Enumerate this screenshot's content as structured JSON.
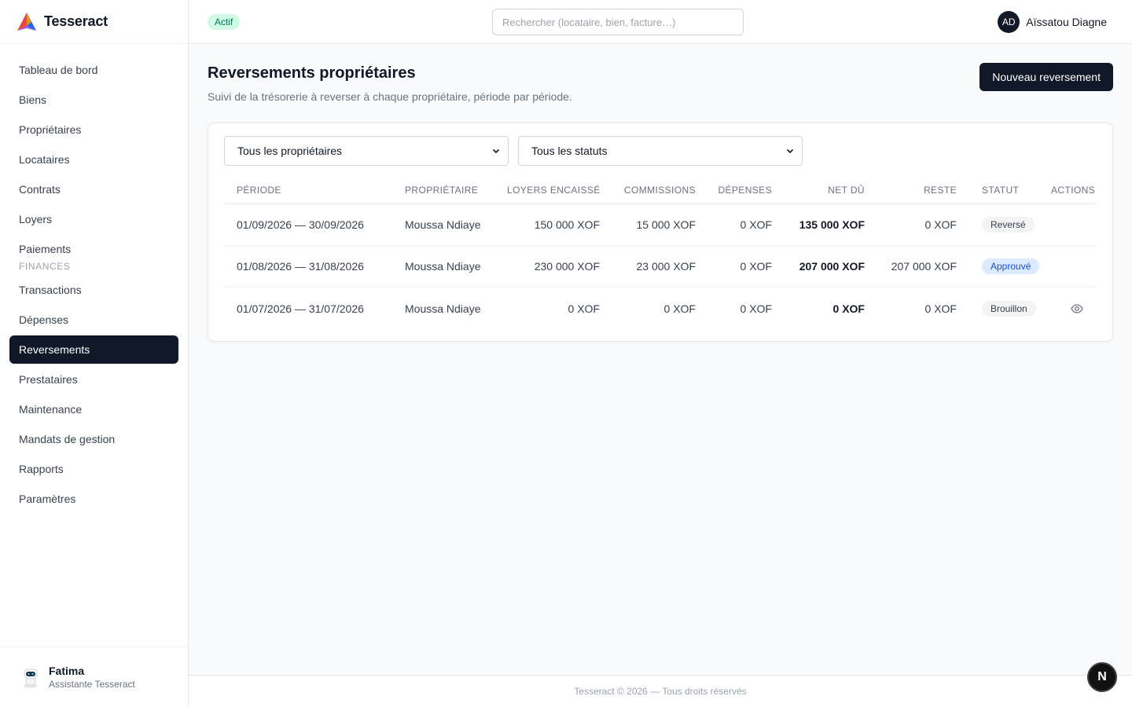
{
  "brand": {
    "name": "Tesseract"
  },
  "sidebar": {
    "items": [
      {
        "label": "Tableau de bord"
      },
      {
        "label": "Biens"
      },
      {
        "label": "Propriétaires"
      },
      {
        "label": "Locataires"
      },
      {
        "label": "Contrats"
      },
      {
        "label": "Loyers"
      },
      {
        "label": "Paiements"
      }
    ],
    "section_label": "FINANCES",
    "finance_items": [
      {
        "label": "Transactions"
      },
      {
        "label": "Dépenses"
      },
      {
        "label": "Reversements",
        "active": true
      },
      {
        "label": "Prestataires"
      },
      {
        "label": "Maintenance"
      },
      {
        "label": "Mandats de gestion"
      },
      {
        "label": "Rapports"
      },
      {
        "label": "Paramètres"
      }
    ],
    "assistant": {
      "name": "Fatima",
      "role": "Assistante Tesseract"
    }
  },
  "topbar": {
    "status": "Actif",
    "search_placeholder": "Rechercher (locataire, bien, facture…)",
    "user": {
      "initials": "AD",
      "name": "Aïssatou Diagne"
    }
  },
  "page": {
    "title": "Reversements propriétaires",
    "subtitle": "Suivi de la trésorerie à reverser à chaque propriétaire, période par période.",
    "new_button": "Nouveau reversement"
  },
  "filters": {
    "owner": "Tous les propriétaires",
    "status": "Tous les statuts"
  },
  "table": {
    "headers": {
      "period": "PÉRIODE",
      "owner": "PROPRIÉTAIRE",
      "rent": "LOYERS ENCAISSÉS",
      "commissions": "COMMISSIONS",
      "expenses": "DÉPENSES",
      "net": "NET DÛ",
      "rest": "RESTE",
      "status": "STATUT",
      "actions": "ACTIONS"
    },
    "rows": [
      {
        "period": "01/09/2026 — 30/09/2026",
        "owner": "Moussa Ndiaye",
        "rent": "150 000 XOF",
        "commissions": "15 000 XOF",
        "expenses": "0 XOF",
        "net": "135 000 XOF",
        "rest": "0 XOF",
        "status": "Reversé"
      },
      {
        "period": "01/08/2026 — 31/08/2026",
        "owner": "Moussa Ndiaye",
        "rent": "230 000 XOF",
        "commissions": "23 000 XOF",
        "expenses": "0 XOF",
        "net": "207 000 XOF",
        "rest": "207 000 XOF",
        "status": "Approuvé"
      },
      {
        "period": "01/07/2026 — 31/07/2026",
        "owner": "Moussa Ndiaye",
        "rent": "0 XOF",
        "commissions": "0 XOF",
        "expenses": "0 XOF",
        "net": "0 XOF",
        "rest": "0 XOF",
        "status": "Brouillon"
      }
    ]
  },
  "footer": {
    "text": "Tesseract © 2026 — Tous droits réservés"
  },
  "dev_badge": {
    "letter": "N"
  },
  "colors": {
    "primary": "#111827",
    "success_bg": "#d1fae5",
    "success_text": "#047857",
    "info_bg": "#dbeafe",
    "info_text": "#1d4ed8"
  }
}
